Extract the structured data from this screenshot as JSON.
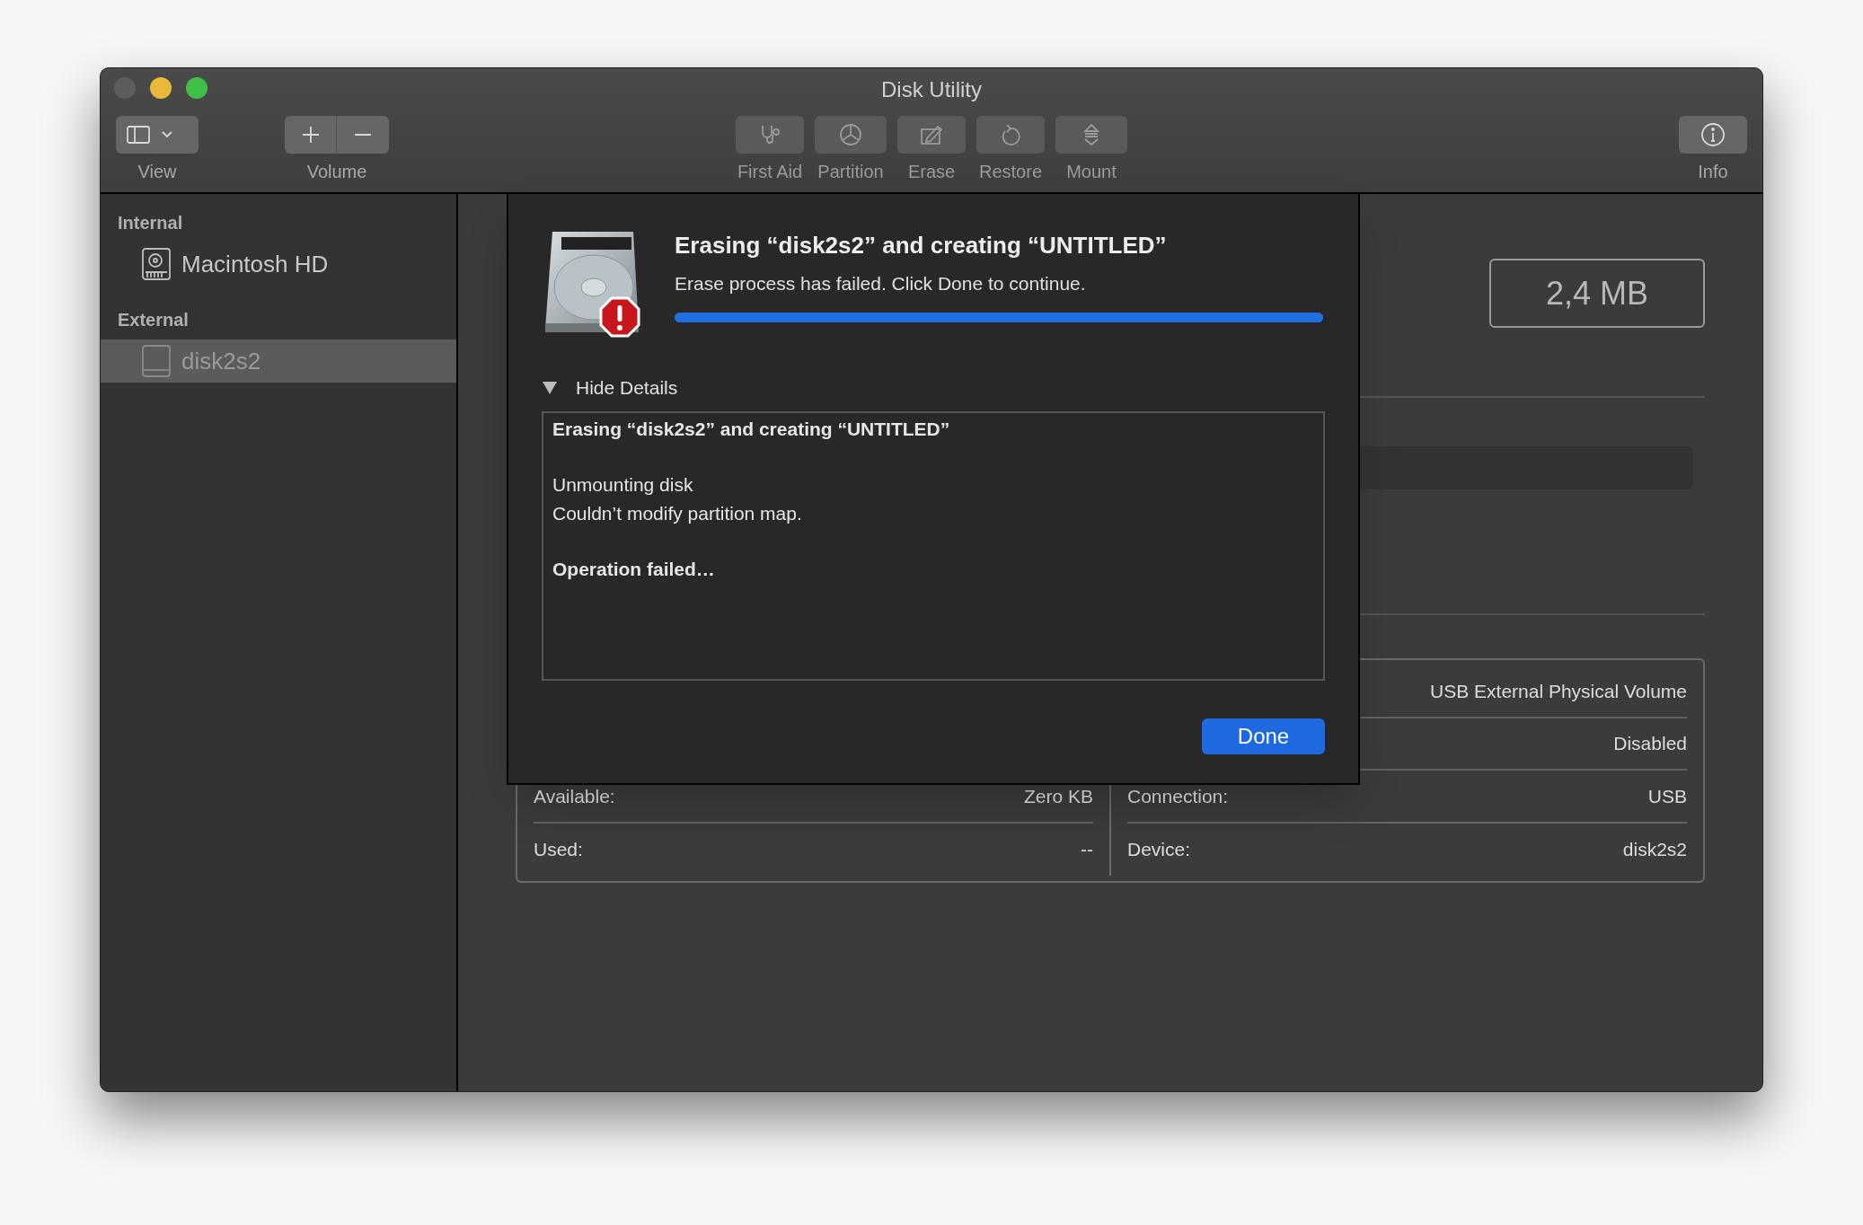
{
  "window": {
    "title": "Disk Utility"
  },
  "toolbar": [
    {
      "label": "View"
    },
    {
      "label": "Volume"
    },
    {
      "label": "First Aid"
    },
    {
      "label": "Partition"
    },
    {
      "label": "Erase"
    },
    {
      "label": "Restore"
    },
    {
      "label": "Mount"
    },
    {
      "label": "Info"
    }
  ],
  "sidebar": {
    "sections": [
      {
        "heading": "Internal",
        "items": [
          {
            "label": "Macintosh HD",
            "selected": false
          }
        ]
      },
      {
        "heading": "External",
        "items": [
          {
            "label": "disk2s2",
            "selected": true
          }
        ]
      }
    ]
  },
  "main": {
    "capacity": "2,4 MB",
    "info_rows": [
      {
        "right_value": "USB External Physical Volume"
      },
      {
        "right_value": "Disabled"
      },
      {
        "left_label": "Available:",
        "left_value": "Zero KB",
        "right_label": "Connection:",
        "right_value": "USB"
      },
      {
        "left_label": "Used:",
        "left_value": "--",
        "right_label": "Device:",
        "right_value": "disk2s2"
      }
    ]
  },
  "dialog": {
    "title": "Erasing “disk2s2” and creating “UNTITLED”",
    "message": "Erase process has failed. Click Done to continue.",
    "progress": {
      "level": 1
    },
    "disclosure": {
      "label": "Hide Details",
      "expanded": true
    },
    "details": [
      {
        "bold": true,
        "lines": [
          "Erasing “disk2s2” and creating “UNTITLED”"
        ]
      },
      {
        "bold": false,
        "lines": [
          "Unmounting disk",
          "Couldn’t modify partition map."
        ]
      },
      {
        "bold": true,
        "lines": [
          "Operation failed…"
        ]
      }
    ],
    "button": "Done"
  }
}
